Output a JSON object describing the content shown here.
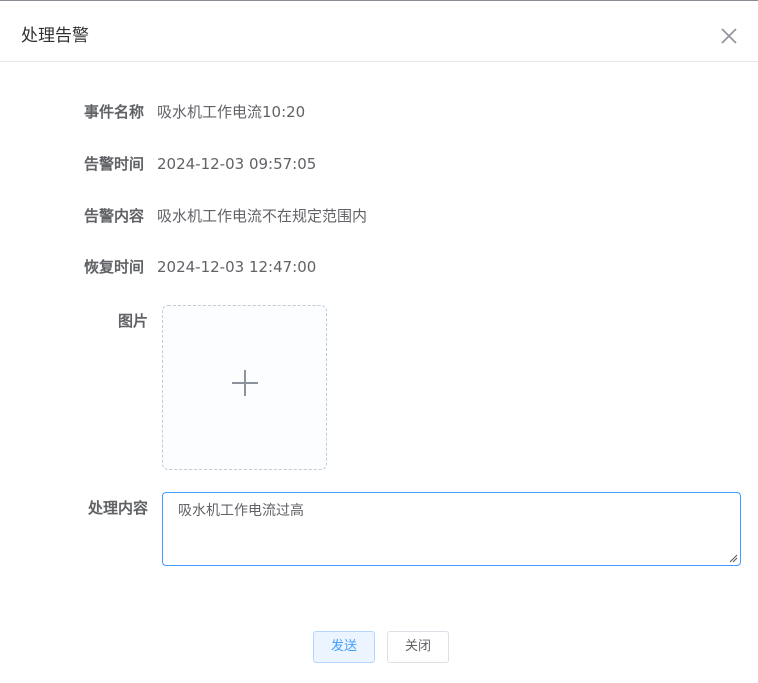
{
  "dialog": {
    "title": "处理告警",
    "close_icon": "close-icon"
  },
  "fields": {
    "event_name": {
      "label": "事件名称",
      "value": "吸水机工作电流10:20"
    },
    "alarm_time": {
      "label": "告警时间",
      "value": "2024-12-03 09:57:05"
    },
    "alarm_content": {
      "label": "告警内容",
      "value": "吸水机工作电流不在规定范围内"
    },
    "recovery_time": {
      "label": "恢复时间",
      "value": "2024-12-03 12:47:00"
    },
    "image": {
      "label": "图片",
      "upload_icon": "plus-icon"
    },
    "handle_content": {
      "label": "处理内容",
      "value": "吸水机工作电流过高"
    }
  },
  "footer": {
    "send_label": "发送",
    "close_label": "关闭"
  },
  "colors": {
    "primary": "#409eff",
    "primary_light_bg": "#ecf5ff",
    "text": "#606266",
    "title": "#303133",
    "border": "#dcdfe6"
  }
}
